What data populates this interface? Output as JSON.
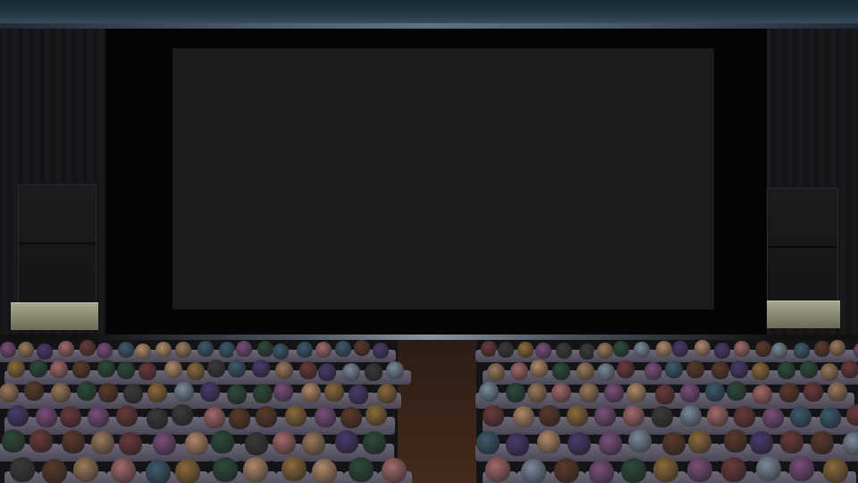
{
  "scene": {
    "description_free": true,
    "screen_color": "#1c1c1d",
    "wall_color": "#0b0b0d",
    "aisle_color": "#3a2518",
    "hair_colors": [
      "#5a3a2a",
      "#7a4f7a",
      "#3d5a6b",
      "#8a6a3a",
      "#2d4a3a",
      "#6a3a3a",
      "#9a7a5a",
      "#4a3a6a",
      "#7a8a9a",
      "#a36a6a",
      "#3a3a3a",
      "#b08a6a"
    ]
  }
}
